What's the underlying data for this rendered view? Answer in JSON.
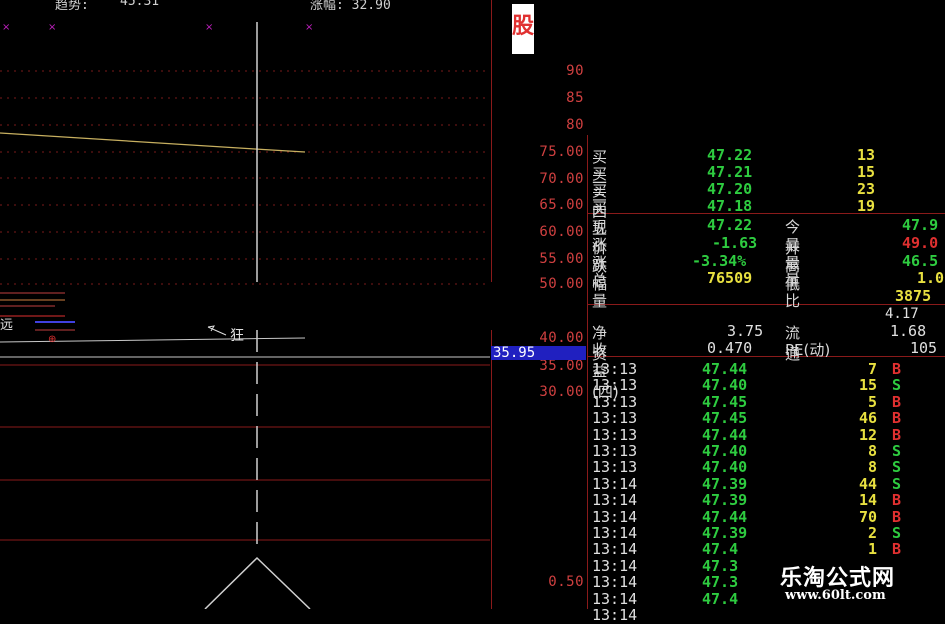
{
  "header": {
    "title_fragment": "趋势:",
    "value_fragment": "45.31",
    "right_fragment": "涨幅: 32.90"
  },
  "price_axis_upper": [
    "90",
    "85",
    "80",
    "75.00",
    "70.00",
    "65.00",
    "60.00",
    "55.00",
    "50.00"
  ],
  "price_axis_lower": [
    "40.00",
    "35.00",
    "30.00"
  ],
  "price_axis_bottom": "0.50",
  "current_marker": "35.95",
  "chart_annotations": {
    "mark1": "狂",
    "mark2": "远",
    "mark3": "⊕"
  },
  "corner_logo_char": "股",
  "quote": {
    "bids": [
      {
        "label": "买二",
        "price": "47.22",
        "vol": "13"
      },
      {
        "label": "买三",
        "price": "47.21",
        "vol": "15"
      },
      {
        "label": "买四",
        "price": "47.20",
        "vol": "23"
      },
      {
        "label": "买五",
        "price": "47.18",
        "vol": "19"
      }
    ],
    "stats": [
      {
        "label": "现价",
        "value": "47.22",
        "label2": "今开",
        "value2": "47.9"
      },
      {
        "label": "涨跌",
        "value": "-1.63",
        "label2": "最高",
        "value2": "49.0"
      },
      {
        "label": "涨幅",
        "value": "-3.34%",
        "label2": "最低",
        "value2": "46.5"
      },
      {
        "label": "总量",
        "value": "76509",
        "label2": "量比",
        "value2": "1.0"
      }
    ],
    "extra1": "3875",
    "extra2": "4.17",
    "stats2": [
      {
        "label": "净资",
        "value": "3.75",
        "label2": "流通",
        "value2": "1.68"
      },
      {
        "label": "收益(四)",
        "value": "0.470",
        "label2": "PE(动)",
        "value2": "105"
      }
    ]
  },
  "ticks": [
    {
      "time": "13:13",
      "price": "47.44",
      "vol": "7",
      "side": "B"
    },
    {
      "time": "13:13",
      "price": "47.40",
      "vol": "15",
      "side": "S"
    },
    {
      "time": "13:13",
      "price": "47.45",
      "vol": "5",
      "side": "B"
    },
    {
      "time": "13:13",
      "price": "47.45",
      "vol": "46",
      "side": "B"
    },
    {
      "time": "13:13",
      "price": "47.44",
      "vol": "12",
      "side": "B"
    },
    {
      "time": "13:13",
      "price": "47.40",
      "vol": "8",
      "side": "S"
    },
    {
      "time": "13:13",
      "price": "47.40",
      "vol": "8",
      "side": "S"
    },
    {
      "time": "13:14",
      "price": "47.39",
      "vol": "44",
      "side": "S"
    },
    {
      "time": "13:14",
      "price": "47.39",
      "vol": "14",
      "side": "B"
    },
    {
      "time": "13:14",
      "price": "47.44",
      "vol": "70",
      "side": "B"
    },
    {
      "time": "13:14",
      "price": "47.39",
      "vol": "2",
      "side": "S"
    },
    {
      "time": "13:14",
      "price": "47.4",
      "vol": "1",
      "side": "B"
    },
    {
      "time": "13:14",
      "price": "47.3",
      "vol": "",
      "side": ""
    },
    {
      "time": "13:14",
      "price": "47.3",
      "vol": "",
      "side": ""
    },
    {
      "time": "13:14",
      "price": "47.4",
      "vol": "",
      "side": ""
    },
    {
      "time": "13:14",
      "price": "",
      "vol": "",
      "side": ""
    }
  ],
  "watermark": {
    "title": "乐淘公式网",
    "url": "www.60lt.com"
  },
  "colors": {
    "background": "#000000",
    "grid": "#8a1a1a",
    "up": "#e03030",
    "down": "#2ecc40",
    "price_line": "#c8b060",
    "marker_bg": "#2020c0"
  }
}
